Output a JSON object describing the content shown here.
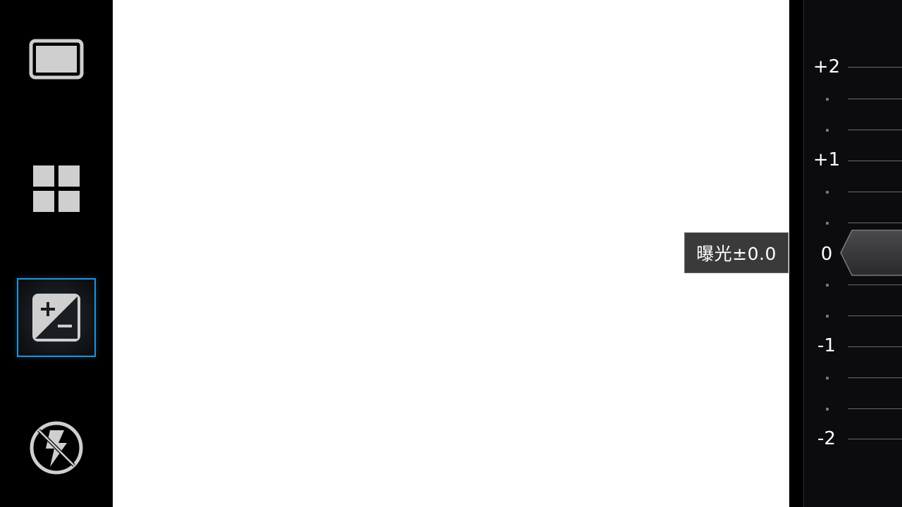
{
  "exposure": {
    "label": "曝光±0.0",
    "value": 0
  },
  "scale": {
    "labels": [
      "+2",
      "+1",
      "0",
      "-1",
      "-2"
    ]
  },
  "modes": [
    {
      "name": "picture-size",
      "icon": "frame-icon"
    },
    {
      "name": "scene-mode",
      "icon": "grid-icon"
    },
    {
      "name": "exposure",
      "icon": "exposure-compensation-icon",
      "active": true
    },
    {
      "name": "flash",
      "icon": "flash-off-icon"
    }
  ],
  "colors": {
    "accent": "#2a8fd8",
    "icon": "#cfcfcf"
  }
}
